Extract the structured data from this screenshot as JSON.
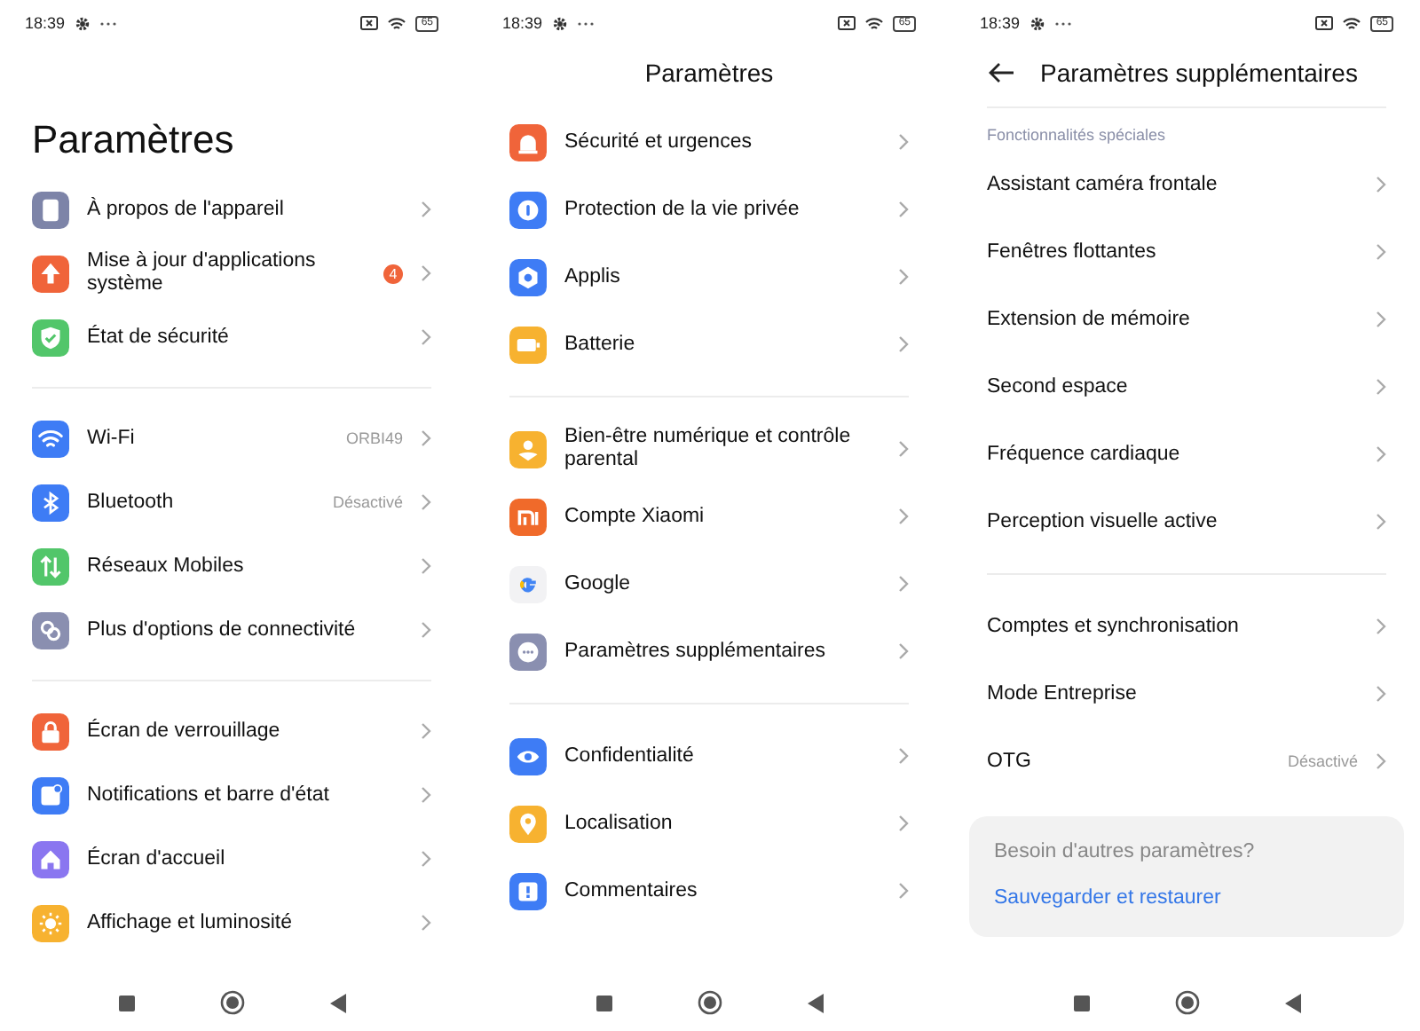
{
  "screens": [
    {
      "status_bar": {
        "time": "18:39",
        "battery": "65"
      },
      "header": {
        "kind": "large",
        "title": "Paramètres"
      },
      "groups": [
        {
          "items": [
            {
              "label": "À propos de l'appareil",
              "color": "#7d84a8"
            },
            {
              "label": "Mise à jour d'applications système",
              "color": "#f0643a",
              "badge": "4"
            },
            {
              "label": "État de sécurité",
              "color": "#52c66a"
            }
          ]
        },
        {
          "items": [
            {
              "label": "Wi-Fi",
              "color": "#3e7cf5",
              "value": "ORBI49"
            },
            {
              "label": "Bluetooth",
              "color": "#3e7cf5",
              "value": "Désactivé"
            },
            {
              "label": "Réseaux Mobiles",
              "color": "#52c66a"
            },
            {
              "label": "Plus d'options de connectivité",
              "color": "#8a8fb0"
            }
          ]
        },
        {
          "items": [
            {
              "label": "Écran de verrouillage",
              "color": "#f0643a"
            },
            {
              "label": "Notifications et barre d'état",
              "color": "#3e7cf5"
            },
            {
              "label": "Écran d'accueil",
              "color": "#8a76f0"
            },
            {
              "label": "Affichage et luminosité",
              "color": "#f7b230"
            }
          ]
        }
      ]
    },
    {
      "status_bar": {
        "time": "18:39",
        "battery": "65"
      },
      "header": {
        "kind": "centered",
        "title": "Paramètres"
      },
      "groups": [
        {
          "items": [
            {
              "label": "Sécurité et urgences",
              "color": "#f0643a"
            },
            {
              "label": "Protection de la vie privée",
              "color": "#3e7cf5"
            },
            {
              "label": "Applis",
              "color": "#3e7cf5"
            },
            {
              "label": "Batterie",
              "color": "#f7b230"
            }
          ]
        },
        {
          "items": [
            {
              "label": "Bien-être numérique et contrôle parental",
              "color": "#f7b230"
            },
            {
              "label": "Compte Xiaomi",
              "color": "#f06a2a"
            },
            {
              "label": "Google",
              "color": "#f2f2f4"
            },
            {
              "label": "Paramètres supplémentaires",
              "color": "#8a8fb0"
            }
          ]
        },
        {
          "items": [
            {
              "label": "Confidentialité",
              "color": "#3e7cf5"
            },
            {
              "label": "Localisation",
              "color": "#f7b230"
            },
            {
              "label": "Commentaires",
              "color": "#3e7cf5"
            }
          ]
        }
      ]
    },
    {
      "status_bar": {
        "time": "18:39",
        "battery": "65"
      },
      "header": {
        "kind": "back",
        "title": "Paramètres supplémentaires"
      },
      "groups": [
        {
          "label": "Fonctionnalités spéciales",
          "items": [
            {
              "label": "Assistant caméra frontale"
            },
            {
              "label": "Fenêtres flottantes"
            },
            {
              "label": "Extension de mémoire"
            },
            {
              "label": "Second espace"
            },
            {
              "label": "Fréquence cardiaque"
            },
            {
              "label": "Perception visuelle active"
            }
          ]
        },
        {
          "items": [
            {
              "label": "Comptes et synchronisation"
            },
            {
              "label": "Mode Entreprise"
            },
            {
              "label": "OTG",
              "value": "Désactivé"
            }
          ]
        }
      ],
      "help_card": {
        "title": "Besoin d'autres paramètres?",
        "links": [
          "Sauvegarder et restaurer"
        ]
      }
    }
  ]
}
